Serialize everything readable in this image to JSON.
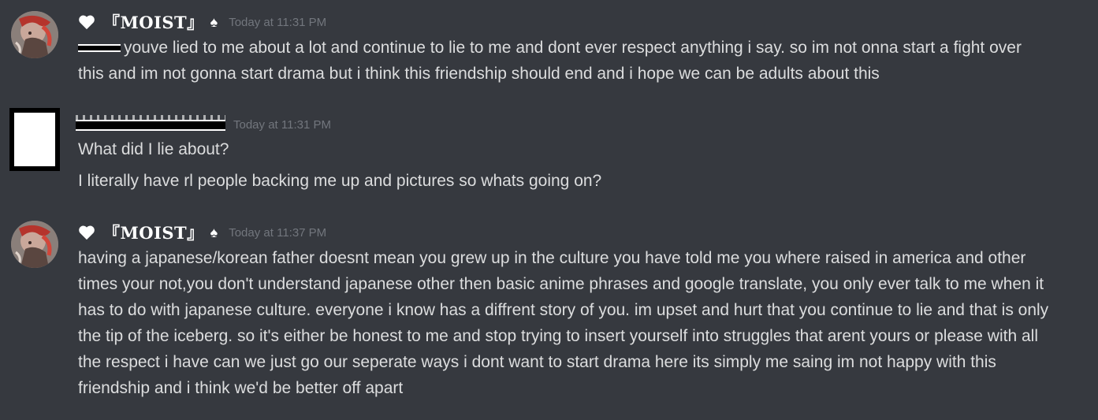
{
  "messages": [
    {
      "username": "『MOIST』",
      "badge_icon": "heart-icon",
      "suffix": "♠",
      "timestamp": "Today at 11:31 PM",
      "lines": [
        "youve lied to me about a lot and continue to lie to me and dont ever respect anything i say. so im not onna start a fight over this and im not gonna start drama but i think this friendship should end and i hope we can be adults about this"
      ]
    },
    {
      "username": "",
      "timestamp": "Today at 11:31 PM",
      "lines": [
        "What did I lie about?",
        "I literally have rl people backing me up and pictures so whats going on?"
      ]
    },
    {
      "username": "『MOIST』",
      "badge_icon": "heart-icon",
      "suffix": "♠",
      "timestamp": "Today at 11:37 PM",
      "lines": [
        "having a japanese/korean father doesnt mean you grew up in the culture you have told me you where raised in america and other times your not,you don't understand japanese other then basic anime phrases and google translate, you only ever talk to me when it has to do with japanese culture. everyone i know has a diffrent story of you. im upset and hurt that you continue to lie and that is only the tip of the iceberg. so it's either be honest to me and stop trying to insert yourself into struggles that arent yours or please with all the respect i have can we just go our seperate ways i dont want to start drama here  its simply me saing im not happy with this friendship and i think we'd be better off apart"
      ]
    }
  ],
  "colors": {
    "background": "#36393f",
    "username": "#ffffff",
    "timestamp": "#72767d",
    "message_text": "#dcddde"
  }
}
